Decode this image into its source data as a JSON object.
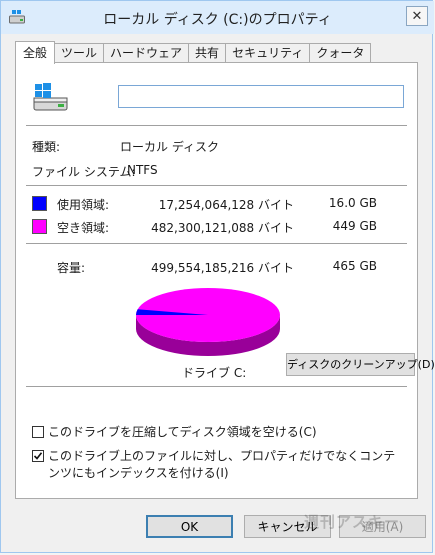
{
  "window": {
    "title": "ローカル ディスク (C:)のプロパティ",
    "close_glyph": "✕"
  },
  "tabs": [
    {
      "label": "全般",
      "active": true
    },
    {
      "label": "ツール",
      "active": false
    },
    {
      "label": "ハードウェア",
      "active": false
    },
    {
      "label": "共有",
      "active": false
    },
    {
      "label": "セキュリティ",
      "active": false
    },
    {
      "label": "クォータ",
      "active": false
    }
  ],
  "general": {
    "name_value": "",
    "type_label": "種類:",
    "type_value": "ローカル ディスク",
    "fs_label": "ファイル システム:",
    "fs_value": "NTFS",
    "used": {
      "label": "使用領域:",
      "bytes": "17,254,064,128 バイト",
      "size": "16.0 GB",
      "color": "#0000ff"
    },
    "free": {
      "label": "空き領域:",
      "bytes": "482,300,121,088 バイト",
      "size": "449 GB",
      "color": "#ff00ff"
    },
    "capacity": {
      "label": "容量:",
      "bytes": "499,554,185,216 バイト",
      "size": "465 GB"
    },
    "drive_label": "ドライブ C:",
    "cleanup_button": "ディスクのクリーンアップ(D)",
    "usage_fraction": 0.0345
  },
  "options": {
    "compress": {
      "label": "このドライブを圧縮してディスク領域を空ける(C)",
      "checked": false
    },
    "index": {
      "label": "このドライブ上のファイルに対し、プロパティだけでなくコンテンツにもインデックスを付ける(I)",
      "checked": true
    }
  },
  "buttons": {
    "ok": "OK",
    "cancel": "キャンセル",
    "apply": "適用(A)"
  },
  "watermark": "週刊アスキー",
  "colors": {
    "titlebar": "#dcecfc",
    "accent": "#3c7fb1",
    "pie_used": "#0000ff",
    "pie_free": "#ff00ff"
  }
}
